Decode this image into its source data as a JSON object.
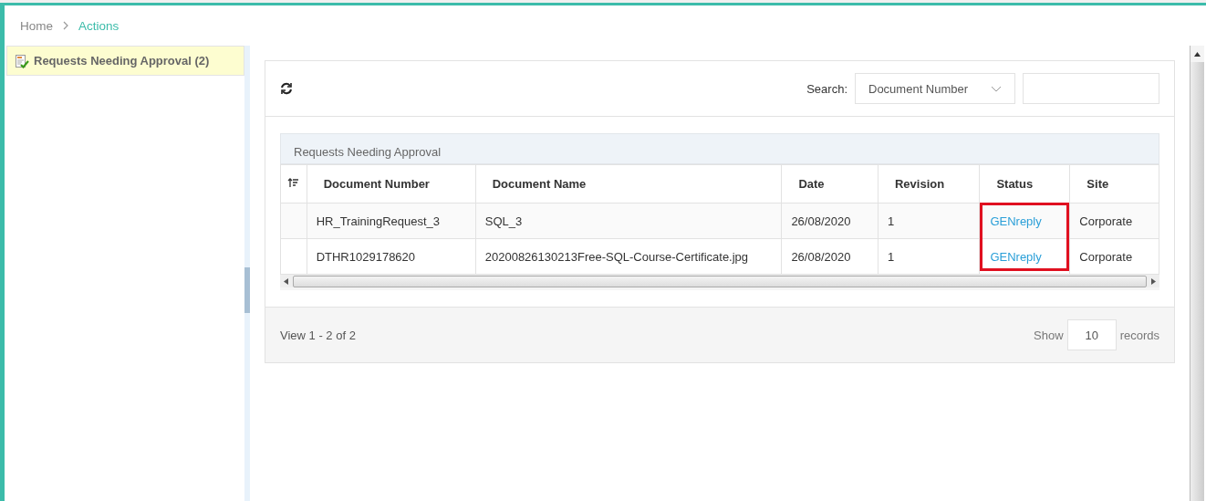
{
  "breadcrumb": [
    {
      "label": "Home",
      "current": false
    },
    {
      "label": "Actions",
      "current": true
    }
  ],
  "sidebar": {
    "items": [
      {
        "label": "Requests Needing Approval (2)",
        "selected": true
      }
    ]
  },
  "toolbar": {
    "search_label": "Search:",
    "search_field": "Document Number"
  },
  "table": {
    "caption": "Requests Needing Approval",
    "status_highlighted": true,
    "columns": [
      "Document Number",
      "Document Name",
      "Date",
      "Revision",
      "Status",
      "Site"
    ],
    "rows": [
      {
        "cells": [
          "HR_TrainingRequest_3",
          "SQL_3",
          "26/08/2020",
          "1",
          "GENreply",
          "Corporate"
        ]
      },
      {
        "cells": [
          "DTHR1029178620",
          "20200826130213Free-SQL-Course-Certificate.jpg",
          "26/08/2020",
          "1",
          "GENreply",
          "Corporate"
        ]
      }
    ]
  },
  "footer": {
    "view_text": "View 1 - 2 of 2",
    "show_label": "Show",
    "page_size": "10",
    "records_label": "records"
  }
}
